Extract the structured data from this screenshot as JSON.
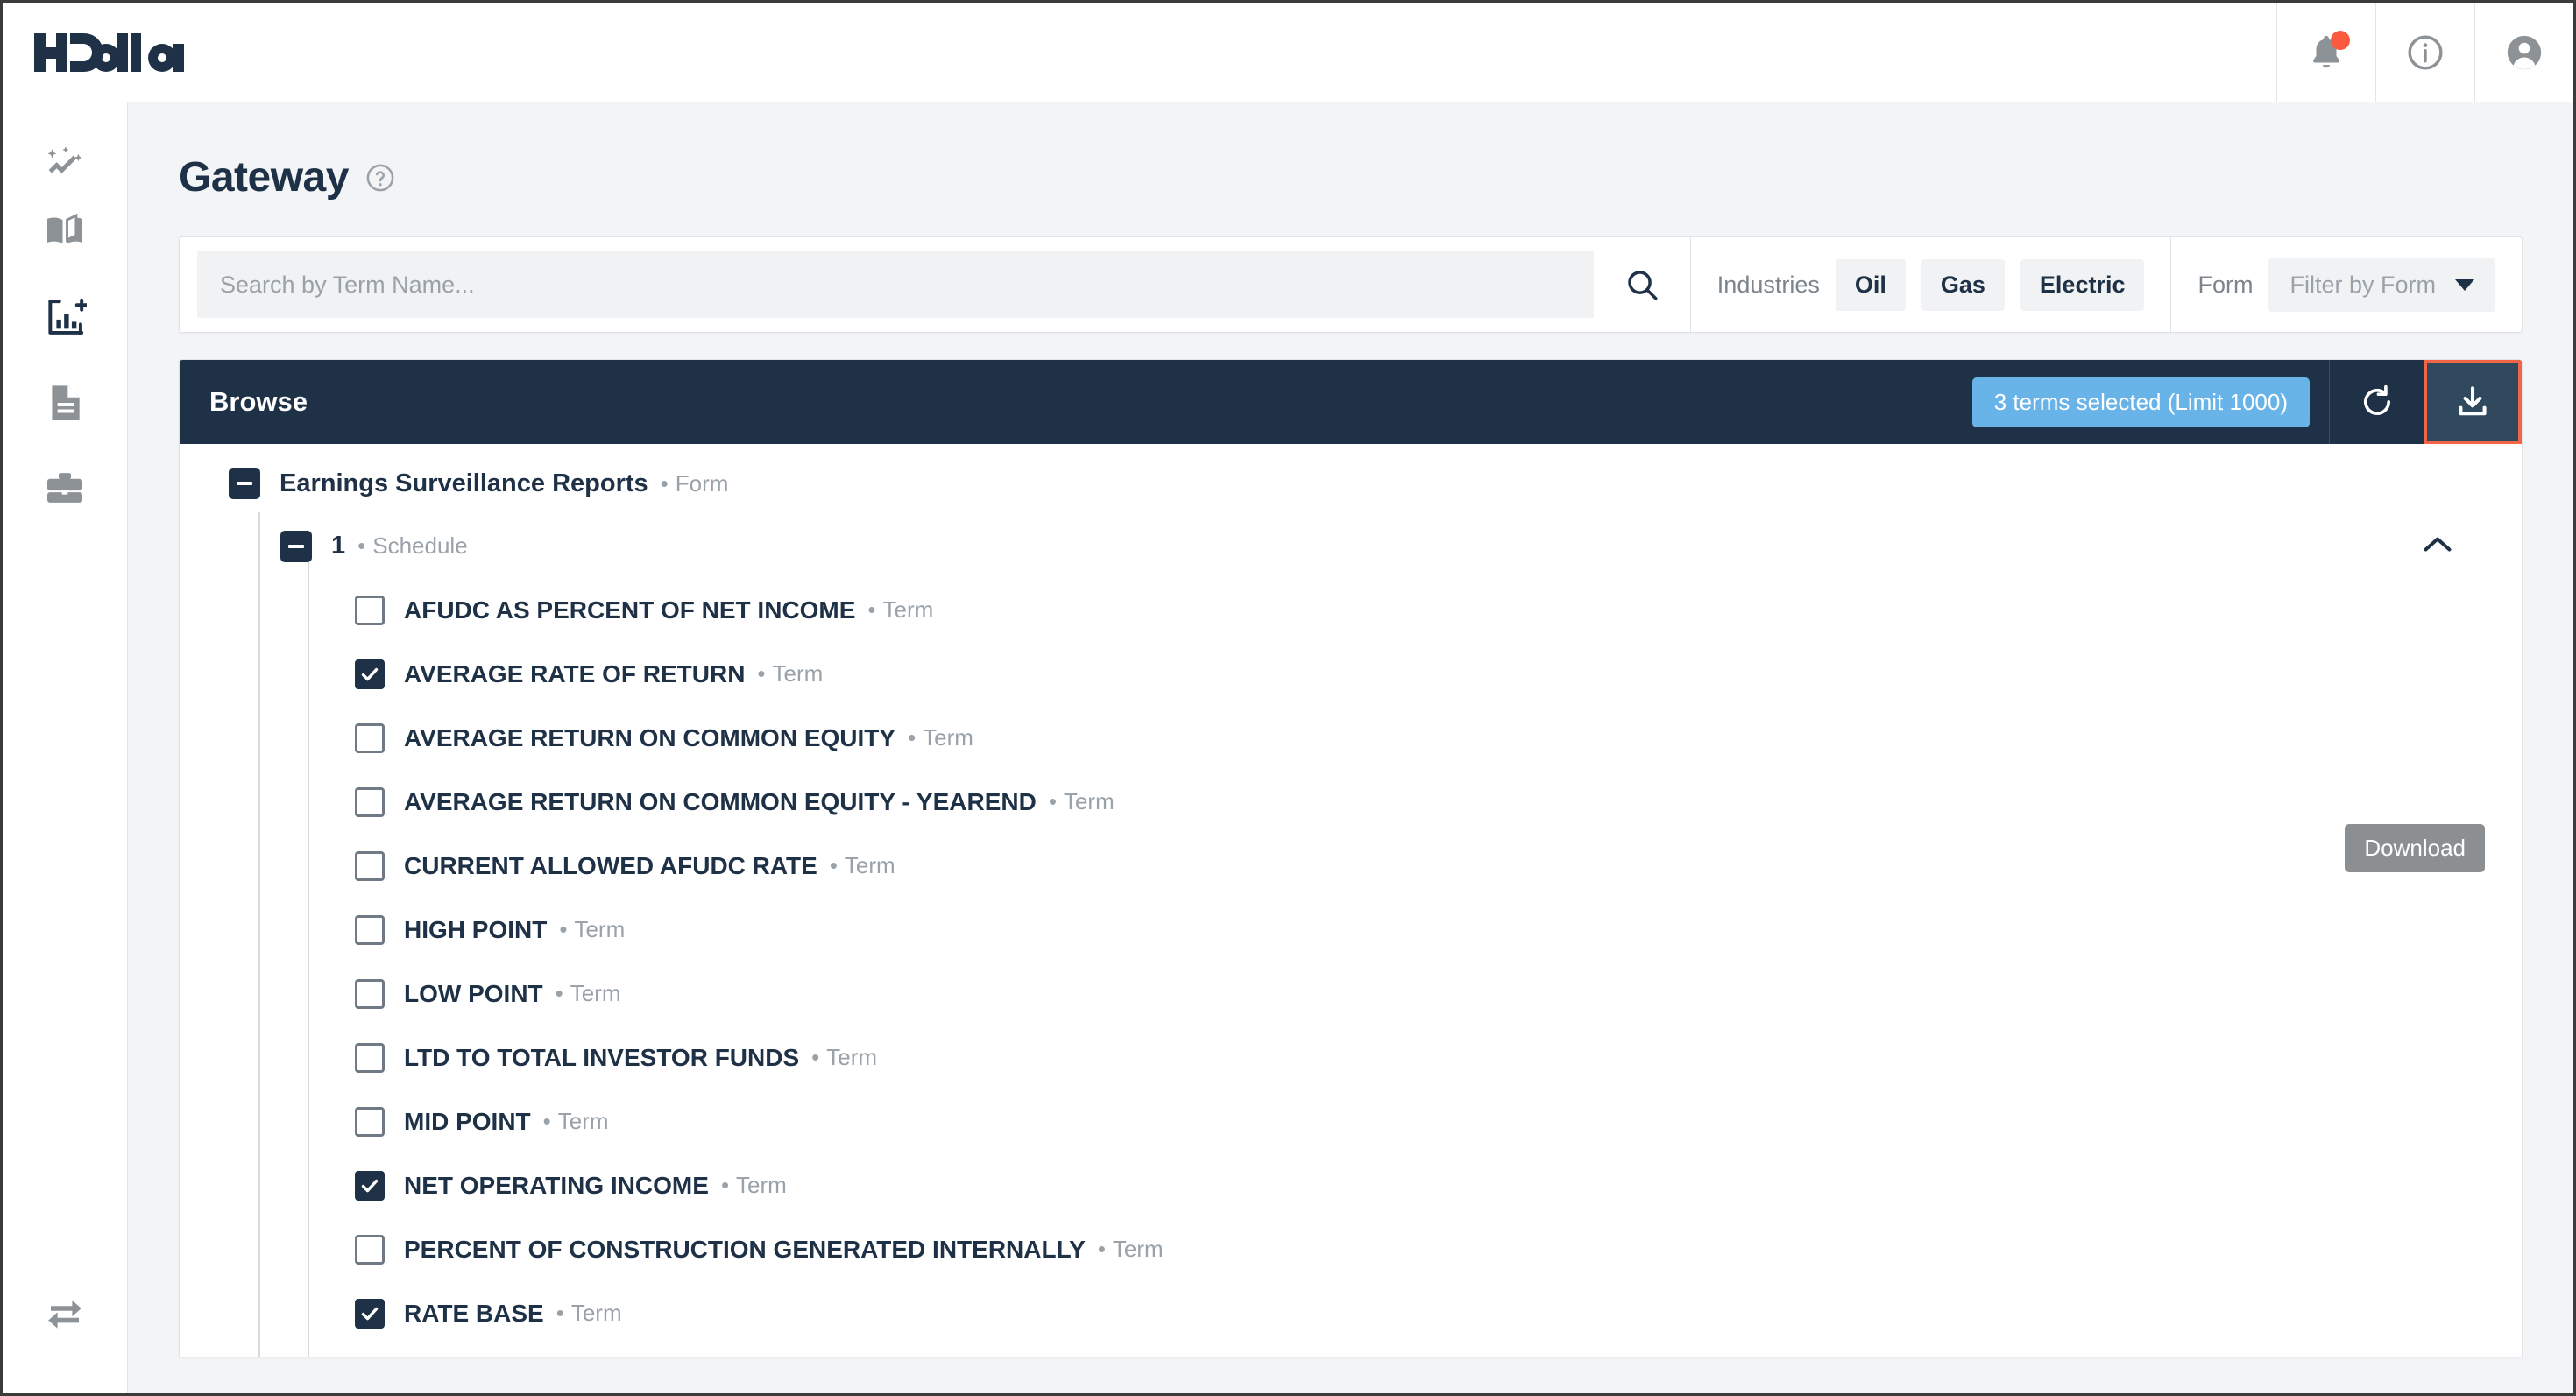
{
  "brand": {
    "name": "HData"
  },
  "topbar": {
    "icons": [
      {
        "name": "notifications-icon",
        "label": "Notifications",
        "badge": true
      },
      {
        "name": "info-icon",
        "label": "Info"
      },
      {
        "name": "account-icon",
        "label": "Account"
      }
    ]
  },
  "sidebar": {
    "items": [
      {
        "name": "insights-icon",
        "label": "Insights",
        "active": false
      },
      {
        "name": "library-icon",
        "label": "Library",
        "active": false
      },
      {
        "name": "chart-plus-icon",
        "label": "New Chart",
        "active": true
      },
      {
        "name": "document-icon",
        "label": "Documents",
        "active": false
      },
      {
        "name": "briefcase-icon",
        "label": "Portfolio",
        "active": false
      }
    ],
    "bottom": {
      "name": "collapse-toggle-icon",
      "label": "Toggle Sidebar"
    }
  },
  "page": {
    "title": "Gateway",
    "help_icon": "help-circle-icon"
  },
  "search": {
    "placeholder": "Search by Term Name...",
    "value": "",
    "button_icon": "search-icon"
  },
  "filters": {
    "industries_label": "Industries",
    "industries": [
      {
        "label": "Oil"
      },
      {
        "label": "Gas"
      },
      {
        "label": "Electric"
      }
    ],
    "form_label": "Form",
    "form_placeholder": "Filter by Form"
  },
  "browse": {
    "title": "Browse",
    "selected_badge": "3 terms selected (Limit 1000)",
    "reset_icon": "reset-icon",
    "download_icon": "download-icon",
    "download_tooltip": "Download",
    "highlight_color": "#f26546",
    "badge_color": "#68b3e8"
  },
  "tree": {
    "form": {
      "label": "Earnings Surveillance Reports",
      "kind": "Form",
      "separator": "•"
    },
    "schedule": {
      "label": "1",
      "kind": "Schedule",
      "separator": "•"
    },
    "term_kind": "Term",
    "separator": "•",
    "terms": [
      {
        "label": "AFUDC AS PERCENT OF NET INCOME",
        "kind": "Term",
        "checked": false
      },
      {
        "label": "AVERAGE RATE OF RETURN",
        "kind": "Term",
        "checked": true
      },
      {
        "label": "AVERAGE RETURN ON COMMON EQUITY",
        "kind": "Term",
        "checked": false
      },
      {
        "label": "AVERAGE RETURN ON COMMON EQUITY - YEAREND",
        "kind": "Term",
        "checked": false
      },
      {
        "label": "CURRENT ALLOWED AFUDC RATE",
        "kind": "Term",
        "checked": false
      },
      {
        "label": "HIGH POINT",
        "kind": "Term",
        "checked": false
      },
      {
        "label": "LOW POINT",
        "kind": "Term",
        "checked": false
      },
      {
        "label": "LTD TO TOTAL INVESTOR FUNDS",
        "kind": "Term",
        "checked": false
      },
      {
        "label": "MID POINT",
        "kind": "Term",
        "checked": false
      },
      {
        "label": "NET OPERATING INCOME",
        "kind": "Term",
        "checked": true
      },
      {
        "label": "PERCENT OF CONSTRUCTION GENERATED INTERNALLY",
        "kind": "Term",
        "checked": false
      },
      {
        "label": "RATE BASE",
        "kind": "Term",
        "checked": true
      }
    ]
  }
}
